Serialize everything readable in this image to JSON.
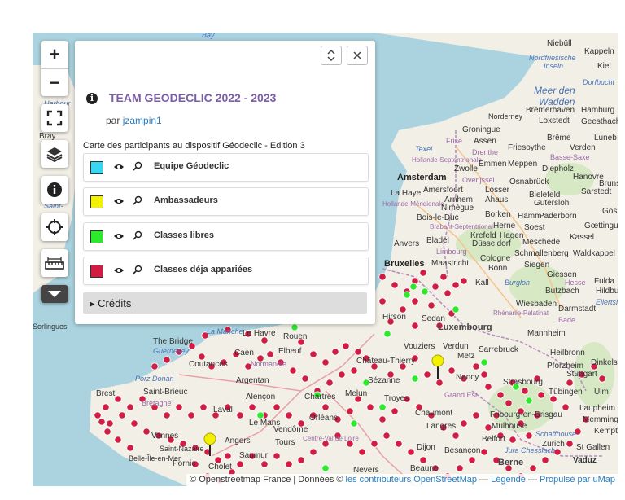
{
  "map": {
    "labels": {
      "bay": "Bay",
      "harbour": "Harbour",
      "bray": "Bray",
      "saint": "Saint-",
      "sorlingues": "Sorlingues",
      "niebull": "Niebüll",
      "kappeln": "Kappeln",
      "nordfriesische": "Nordfriesische",
      "inseln": "Inseln",
      "kiel": "Kiel",
      "dorfbucht": "Dorfbucht",
      "meer_den": "Meer den",
      "wadden": "Wadden",
      "bremerhaven": "Bremerhaven",
      "hamburg": "Hamburg",
      "norderney": "Norderney",
      "loxstedt": "Loxstedt",
      "geesthacht": "Geesthacht",
      "groningue": "Groningue",
      "frise": "Frise",
      "assen": "Assen",
      "bremen": "Brême",
      "luneb": "Luneb",
      "texel": "Texel",
      "drenthe": "Drenthe",
      "friesoythe": "Friesoythe",
      "verden": "Verden",
      "hollande_sept": "Hollande-Septentrionale",
      "zwolle": "Zwolle",
      "emmen": "Emmen",
      "meppen": "Meppen",
      "diepholz": "Diepholz",
      "basse_saxe": "Basse-Saxe",
      "amsterdam": "Amsterdam",
      "overijssel": "Overijssel",
      "osnabruck": "Osnabrück",
      "hanovre": "Hanovre",
      "bruns": "Bruns",
      "la_haye": "La Haye",
      "amersfoort": "Amersfoort",
      "losser": "Losser",
      "bielefeld": "Bielefeld",
      "sarstedt": "Sarstedt",
      "hollande_merid": "Hollande-Méridionale",
      "arnhem": "Arnhem",
      "ahaus": "Ahaus",
      "gutersloh": "Gütersloh",
      "nimegue": "Nimègue",
      "hamm": "Hamm",
      "paderborn": "Paderborn",
      "gosl": "Gosl",
      "bois_le_duc": "Bois-le-Duc",
      "borken": "Borken",
      "goettingue": "Gœttingue",
      "brabant_sept": "Brabant-Septentrional",
      "herne": "Herne",
      "soest": "Soest",
      "krefeld": "Krefeld",
      "hagen": "Hagen",
      "kassel": "Kassel",
      "anvers": "Anvers",
      "bladel": "Bladel",
      "dusseldorf": "Düsseldorf",
      "meschede": "Meschede",
      "limbourg": "Limbourg",
      "schmallenberg": "Schmallenberg",
      "waldkappel": "Waldkappel",
      "bruxelles": "Bruxelles",
      "maastricht": "Maastricht",
      "cologne": "Cologne",
      "siegen": "Siegen",
      "bonn": "Bonn",
      "giessen": "Giessen",
      "kall": "Kall",
      "burglos": "Burgloh",
      "hesse": "Hesse",
      "fulda": "Fulda",
      "butzbach": "Butzbach",
      "hildbu": "Hildbu",
      "wiesbaden": "Wiesbaden",
      "darmstadt": "Darmstadt",
      "ellertsh": "Ellertsh",
      "hirson": "Hirson",
      "sedan": "Sedan",
      "rhenanie": "Rhénanie-Palatinat",
      "bade": "Bade",
      "luxembourg": "Luxembourg",
      "mannheim": "Mannheim",
      "la_manche": "La Manche",
      "the_bridge": "The Bridge",
      "guernesey": "Guernesey",
      "le_havre": "Le Havre",
      "rouen": "Rouen",
      "caen": "Caen",
      "elbeuf": "Elbeuf",
      "coutances": "Coutances",
      "normandie": "Normandie",
      "verdun": "Verdun",
      "metz": "Metz",
      "sarrebruck": "Sarrebruck",
      "heilbronn": "Heilbronn",
      "dinkelsb": "Dinkelsb",
      "chateau_thierry": "Château-Thierry",
      "vouziers": "Vouziers",
      "nancy": "Nancy",
      "strasbourg": "Strasbourg",
      "pforzheim": "Pforzheim",
      "stuttgart": "Stuttgart",
      "porz_donan": "Porz Donan",
      "argentan": "Argentan",
      "sezanne": "Sézanne",
      "tubingen": "Tübingen",
      "ulm": "Ulm",
      "brest": "Brest",
      "saint_brieuc": "Saint-Brieuc",
      "bretagne": "Bretagne",
      "alencon": "Alençon",
      "chartres": "Chartres",
      "melun": "Melun",
      "troyes": "Troyes",
      "grand_est": "Grand Est",
      "laupheim": "Laupheim",
      "laval": "Laval",
      "chaumont": "Chaumont",
      "fribourg": "Fribourg-en-Brisgau",
      "memmingen": "Memmingen",
      "vannes": "Vannes",
      "le_mans": "Le Mans",
      "orleans": "Orléans",
      "langres": "Langres",
      "mulhouse": "Mulhouse",
      "kempten": "Kempten",
      "vendome": "Vendôme",
      "schaffhouse": "Schaffhouse",
      "angers": "Angers",
      "tours": "Tours",
      "centre": "Centre-Val de Loire",
      "dijon": "Dijon",
      "belfort": "Belfort",
      "zurich": "Zurich",
      "st_gallen": "St Gallen",
      "saint_nazaire": "Saint-Nazaire",
      "saumur": "Saumur",
      "besancon": "Besançon",
      "jura": "Jura Chesslach",
      "pornic": "Pornic",
      "cholet": "Cholet",
      "nevers": "Nevers",
      "beaune": "Beaune",
      "berne": "Berne",
      "vaduz": "Vaduz",
      "belle_ile": "Belle-Île-en-Mer"
    }
  },
  "controls": {
    "zoom_in": "+",
    "zoom_out": "−",
    "fullscreen_icon": "fullscreen-icon",
    "layers_icon": "layers-icon",
    "info_icon": "info-icon",
    "locate_icon": "locate-icon",
    "measure_icon": "measure-icon",
    "more_icon": "chevron-down-icon"
  },
  "panel": {
    "title": "TEAM GEODECLIC 2022 - 2023",
    "by_prefix": "par",
    "author": "jzampin1",
    "description": "Carte des participants au dispositif Géodeclic - Edition 3",
    "layers": [
      {
        "name": "Equipe Géodeclic",
        "color": "#39d6f2"
      },
      {
        "name": "Ambassadeurs",
        "color": "#f2f200"
      },
      {
        "name": "Classes libres",
        "color": "#2ee82e"
      },
      {
        "name": "Classes déja appariées",
        "color": "#cf1d43"
      }
    ],
    "credits_label": "▸ Crédits"
  },
  "attribution": {
    "osm": "© Openstreetmap France | Données ©",
    "contrib": "les contributeurs OpenStreetMap",
    "sep1": " — ",
    "legend": "Légende",
    "sep2": " — ",
    "umap": "Propulsé par uMap"
  },
  "colors": {
    "marker_red": "#cf1d43",
    "marker_green": "#2ee82e",
    "marker_yellow": "#f2f200",
    "accent_title": "#7b5ea7",
    "link": "#2a7ec2"
  }
}
